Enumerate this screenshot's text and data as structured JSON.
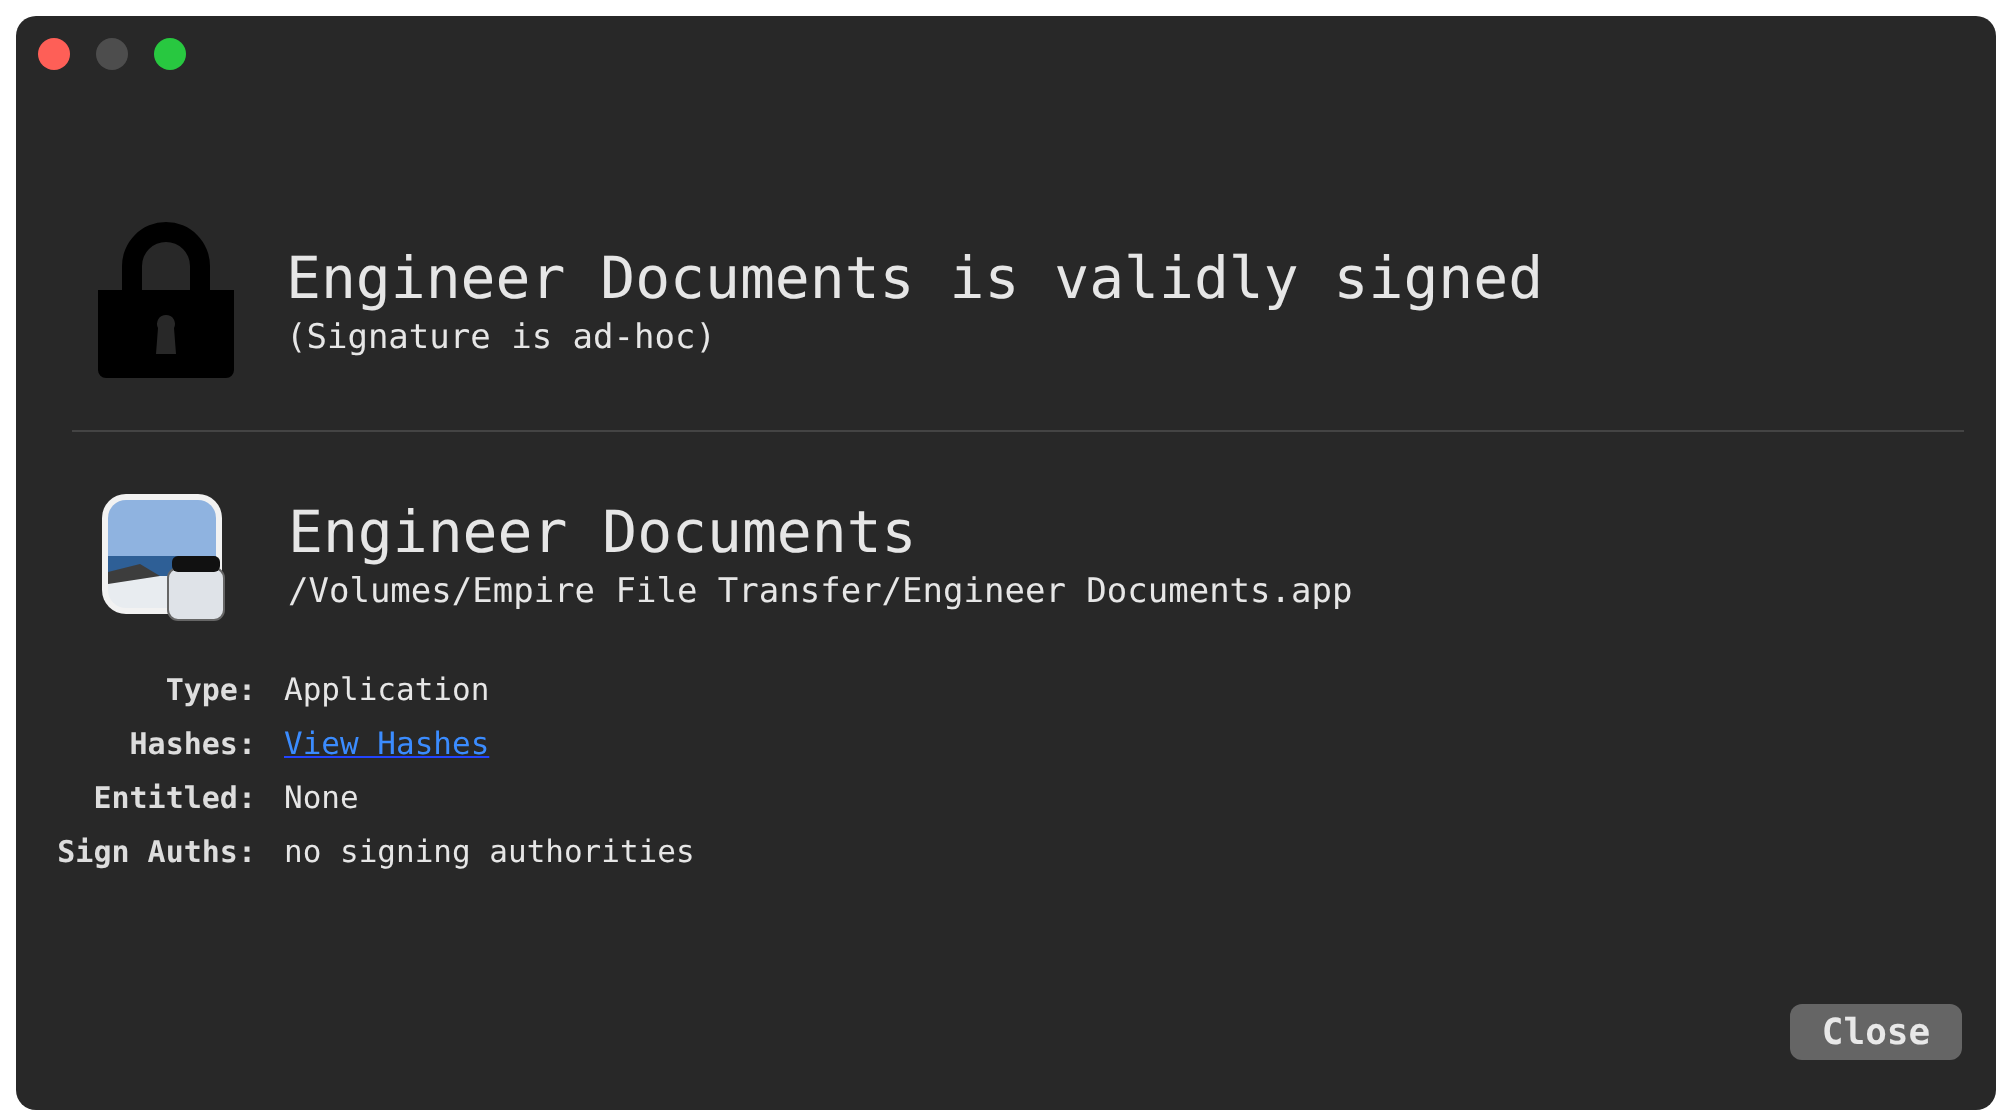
{
  "window": {
    "buttons": [
      {
        "color": "#fe5f57"
      },
      {
        "color": "#4d4d4d"
      },
      {
        "color": "#28c840"
      }
    ]
  },
  "status": {
    "title": "Engineer Documents is validly signed",
    "subtitle": "(Signature is ad-hoc)"
  },
  "app": {
    "name": "Engineer Documents",
    "path": "/Volumes/Empire File Transfer/Engineer Documents.app"
  },
  "details": [
    {
      "label": "Type:",
      "value": "Application",
      "kind": "text"
    },
    {
      "label": "Hashes:",
      "value": "View Hashes",
      "kind": "link"
    },
    {
      "label": "Entitled:",
      "value": "None",
      "kind": "text"
    },
    {
      "label": "Sign Auths:",
      "value": "no signing authorities",
      "kind": "text"
    }
  ],
  "buttons": [
    "Close"
  ]
}
